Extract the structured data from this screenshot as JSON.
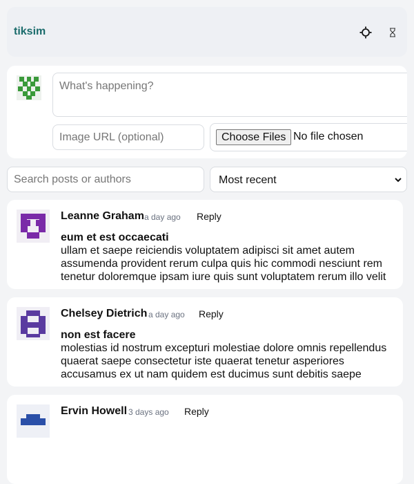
{
  "app": {
    "brand": "tiksim"
  },
  "header_icons": {
    "theme_toggle": "sun-icon",
    "logout": "hourglass-icon"
  },
  "composer": {
    "text_placeholder": "What's happening?",
    "image_url_placeholder": "Image URL (optional)",
    "choose_files_label": "Choose Files",
    "no_file_text": "No file chosen"
  },
  "filters": {
    "search_placeholder": "Search posts or authors",
    "sort_selected": "Most recent"
  },
  "colors": {
    "brand": "#1a6b6b",
    "composer_avatar": "#3a9a3a",
    "avatar_1": "#7a2aa8",
    "avatar_2": "#5a3aa0",
    "avatar_3": "#2a4fa8"
  },
  "posts": [
    {
      "author": "Leanne Graham",
      "time": "a day ago",
      "reply_label": "Reply",
      "title": "eum et est occaecati",
      "body": "ullam et saepe reiciendis voluptatem adipisci sit amet autem assumenda provident rerum culpa quis hic commodi nesciunt rem tenetur doloremque ipsam iure quis sunt voluptatem rerum illo velit"
    },
    {
      "author": "Chelsey Dietrich",
      "time": "a day ago",
      "reply_label": "Reply",
      "title": "non est facere",
      "body": "molestias id nostrum excepturi molestiae dolore omnis repellendus quaerat saepe consectetur iste quaerat tenetur asperiores accusamus ex ut nam quidem est ducimus sunt debitis saepe"
    },
    {
      "author": "Ervin Howell",
      "time": "3 days ago",
      "reply_label": "Reply",
      "title": "",
      "body": ""
    }
  ]
}
